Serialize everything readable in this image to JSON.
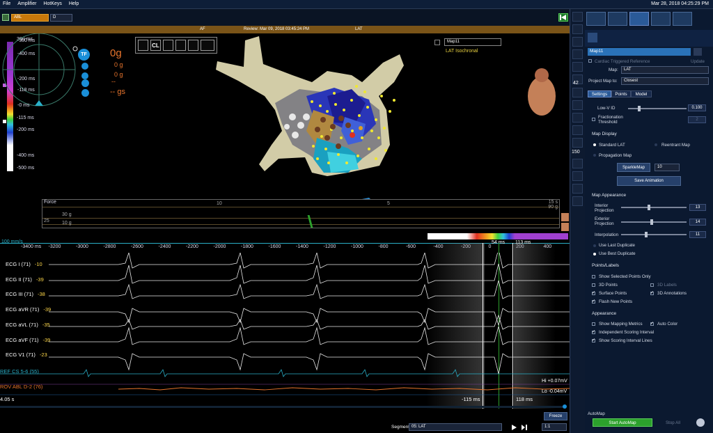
{
  "menu": {
    "file": "File",
    "amplifier": "Amplifier",
    "hotkeys": "HotKeys",
    "help": "Help"
  },
  "clock": "Mar 28, 2018 04:25:29 PM",
  "toolbar": {
    "catheter": "ABL",
    "mode": "D"
  },
  "title": {
    "left": "AF",
    "center": "Review: Mar 09, 2018 03:45:24 PM",
    "right": "LAT"
  },
  "map_select": {
    "name": "Map11",
    "subtitle": "LAT Isochronal"
  },
  "tool_icons": [
    "waveform",
    "CL",
    "gauge",
    "grid",
    "spark",
    "wave-measure",
    "arrow"
  ],
  "color_scale": {
    "labels": [
      "300 ms",
      "-115 ms",
      "-200 ms",
      "-400 ms",
      "-500 ms"
    ],
    "top_labels": [
      "-300 ms",
      "-400 ms",
      "-200 ms",
      "-118 ms",
      "-0 ms"
    ]
  },
  "force_widget": {
    "tf": "TF",
    "force_value": "0g",
    "v1": "0 g",
    "v2": "0 g",
    "v3": "--",
    "gs": "-- gs"
  },
  "force_strip": {
    "title": "Force",
    "tick10": "10",
    "tick5": "5",
    "tick15": "15 s",
    "r1": "30 g",
    "r2": "25",
    "r3": "10 g",
    "topval": "90 g"
  },
  "ruler": {
    "speed": "100 mm/s",
    "ticks": [
      "-3400 ms",
      "-3200",
      "-3000",
      "-2800",
      "-2600",
      "-2400",
      "-2200",
      "-2000",
      "-1800",
      "-1600",
      "-1400",
      "-1200",
      "-1000",
      "-800",
      "-600",
      "-400",
      "-200",
      "0",
      "200",
      "400"
    ],
    "marker1": "54 ms",
    "marker2": "113 ms"
  },
  "channels": [
    {
      "name": "ECG I (71)",
      "val": "-10"
    },
    {
      "name": "ECG II (71)",
      "val": "-39"
    },
    {
      "name": "ECG III (71)",
      "val": "-38"
    },
    {
      "name": "ECG aVR (71)",
      "val": "-39"
    },
    {
      "name": "ECG aVL (71)",
      "val": "-35"
    },
    {
      "name": "ECG aVF (71)",
      "val": "-39"
    },
    {
      "name": "ECG V1 (71)",
      "val": "-23"
    }
  ],
  "ref_cs": "REF CS   5-6 (55)",
  "rov_abl": "ROV ABL   D-2 (76)",
  "hi": "Hi +0.07mV",
  "lo": "Lo -0.04mV",
  "time_left": "4.05 s",
  "bottom_marks": {
    "m1": "-115 ms",
    "m2": "118 ms"
  },
  "freeze": "Freeze",
  "segment": {
    "label": "Segment",
    "value": "05: LAT",
    "ratio": "1:1"
  },
  "panel": {
    "map_name": "Map11",
    "cardiac_ref": "Cardiac Triggered Reference",
    "update": "Update",
    "map_label": "Map:",
    "map_value": "LAT",
    "project_label": "Project Map to:",
    "project_value": "Closest",
    "tabs": [
      "Settings",
      "Points",
      "Model"
    ],
    "lowv_label": "Low-V ID",
    "lowv_val": "0.100",
    "fract_label": "Fractionation Threshold",
    "fract_val": "2",
    "map_display": "Map Display",
    "standard_lat": "Standard LAT",
    "reentrant": "Reentrant Map",
    "propagation": "Propagation Map",
    "sparkle": "SparkleMap",
    "sparkle_val": "10",
    "save_anim": "Save Animation",
    "map_appearance": "Map Appearance",
    "interior": "Interior Projection",
    "interior_val": "13",
    "exterior": "Exterior Projection",
    "exterior_val": "14",
    "interpolation": "Interpolation",
    "interp_val": "11",
    "use_last": "Use Last Duplicate",
    "use_best": "Use Best Duplicate",
    "points_labels": "Points/Labels",
    "show_selected": "Show Selected Points Only",
    "points3d": "3D Points",
    "labels3d": "3D Labels",
    "surface": "Surface Points",
    "annot3d": "3D Annotations",
    "flash": "Flash New Points",
    "appearance": "Appearance",
    "show_metrics": "Show Mapping Metrics",
    "auto_color": "Auto Color",
    "indep": "Independent Scoring Interval",
    "scoring_lines": "Show Scoring Interval Lines",
    "automap": "AutoMap",
    "start_automap": "Start AutoMap",
    "stop_all": "Stop All"
  },
  "vtool_values": {
    "zoom": "42",
    "scale": "150"
  },
  "colors": {
    "accent": "#1a8fd8",
    "orange": "#c8780a",
    "panel": "#0b1930",
    "green": "#2ca02c"
  }
}
